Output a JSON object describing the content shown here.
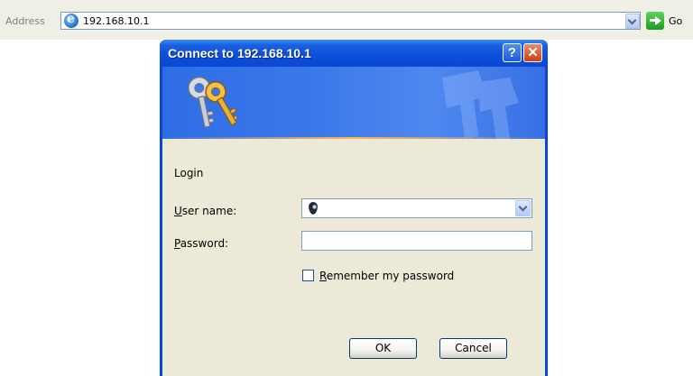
{
  "browser": {
    "address_label": "Address",
    "address_value": "192.168.10.1",
    "go_label": "Go"
  },
  "dialog": {
    "title": "Connect to 192.168.10.1",
    "help_glyph": "?",
    "close_glyph": "✕",
    "login_label": "Login",
    "username_label_accel": "U",
    "username_label_rest": "ser name:",
    "username_value": "",
    "password_label_accel": "P",
    "password_label_rest": "assword:",
    "password_value": "",
    "remember_accel": "R",
    "remember_rest": "emember my password",
    "remember_checked": false,
    "ok_label": "OK",
    "cancel_label": "Cancel"
  },
  "icons": {
    "address_page": "ie-icon",
    "address_dropdown": "chevron-down-icon",
    "go": "arrow-right-icon",
    "banner": "keys-icon",
    "user": "user-icon"
  },
  "colors": {
    "titlebar": "#0a48d2",
    "dialog_body": "#ece9d8",
    "banner": "#3b78ea"
  }
}
